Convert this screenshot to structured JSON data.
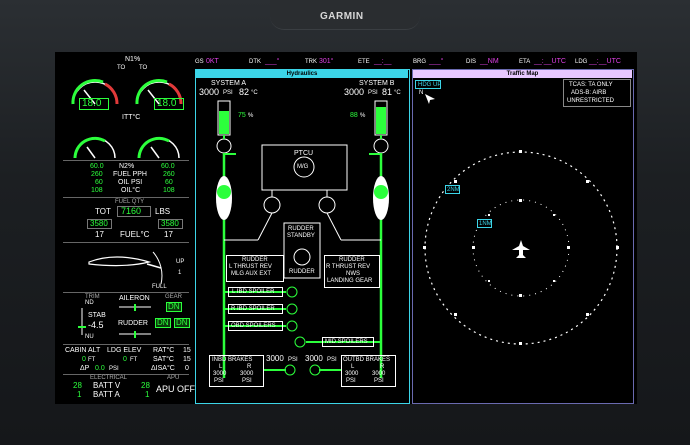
{
  "bezel": {
    "brand": "GARMIN"
  },
  "topbar": {
    "gs_label": "GS",
    "gs_value": "0KT",
    "dtk_label": "DTK",
    "dtk_value": "___°",
    "trk_label": "TRK",
    "trk_value": "301°",
    "ete_label": "ETE",
    "ete_value": "__:__",
    "brg_label": "BRG",
    "brg_value": "___°",
    "dis_label": "DIS",
    "dis_value": "__NM",
    "eta_label": "ETA",
    "eta_value": "__:__UTC",
    "ldg_label": "LDG",
    "ldg_value": "__:__UTC"
  },
  "engine": {
    "n1_label": "N1%",
    "to_left": "TO",
    "to_right": "TO",
    "n1_left": "18.0",
    "n1_right": "18.0",
    "itt_label": "ITT°C",
    "n2_left": "60.0",
    "n2_label": "N2%",
    "n2_right": "60.0",
    "ff_left": "260",
    "ff_label": "FUEL PPH",
    "ff_right": "260",
    "op_left": "60",
    "op_label": "OIL PSI",
    "op_right": "60",
    "ot_left": "108",
    "ot_label": "OIL°C",
    "ot_right": "108",
    "fuel_qty_label": "FUEL QTY",
    "tot_label": "TOT",
    "tot_value": "7160",
    "tot_unit": "LBS",
    "fq_left": "3580",
    "fq_right": "3580",
    "ft_left": "17",
    "ft_label": "FUEL°C",
    "ft_right": "17",
    "flap_up": "UP",
    "flap_1": "1",
    "flap_full": "FULL",
    "trim_label": "TRIM",
    "stab_nd": "ND",
    "stab_label": "STAB",
    "stab_value": "-4.5",
    "stab_nu": "NU",
    "aileron_label": "AILERON",
    "rudder_label": "RUDDER",
    "gear_label": "GEAR",
    "gear_n": "DN",
    "gear_l": "DN",
    "gear_r": "DN",
    "cabin_alt_label": "CABIN ALT",
    "cabin_alt_value": "0",
    "cabin_alt_unit": "FT",
    "ldg_elev_label": "LDG ELEV",
    "ldg_elev_value": "0",
    "ldg_elev_unit": "FT",
    "dp_label": "ΔP",
    "dp_value": "0.0",
    "dp_unit": "PSI",
    "rat_label": "RAT°C",
    "rat_value": "15",
    "sat_label": "SAT°C",
    "sat_value": "15",
    "isa_label": "ΔISA°C",
    "isa_value": "0",
    "electrical_label": "ELECTRICAL",
    "apu_label": "APU",
    "batt_v_left": "28",
    "batt_v_label": "BATT V",
    "batt_v_right": "28",
    "batt_a_left": "1",
    "batt_a_label": "BATT A",
    "batt_a_right": "1",
    "apu_status": "APU OFF"
  },
  "hydraulics": {
    "title": "Hydraulics",
    "sys_a": "SYSTEM A",
    "sys_b": "SYSTEM B",
    "a_psi": "3000",
    "b_psi": "3000",
    "psi": "PSI",
    "a_temp": "82",
    "b_temp": "81",
    "degc": "°C",
    "a_qty": "75",
    "b_qty": "88",
    "pct": "%",
    "ptcu": "PTCU",
    "mg": "M/G",
    "rudder_standby": [
      "RUDDER",
      "STANDBY"
    ],
    "rudder_box": "RUDDER",
    "left_list": [
      "RUDDER",
      "L THRUST REV",
      "MLG AUX EXT"
    ],
    "right_list": [
      "RUDDER",
      "R THRUST REV",
      "NWS",
      "LANDING GEAR"
    ],
    "l_ibd": "L IBD SPOILER",
    "r_ibd": "R IBD SPOILER",
    "obd": "OBD SPOILERS",
    "mid": "MID SPOILERS",
    "inbd": "INBD BRAKES",
    "outbd": "OUTBD BRAKES",
    "l": "L",
    "r": "R",
    "brk_val": "3000",
    "accum_left": "3000",
    "accum_right": "3000"
  },
  "traffic": {
    "title": "Traffic Map",
    "hdg_up": "HDG UP",
    "n_label": "N",
    "tcas": "TCAS: TA ONLY",
    "adsb": "ADS-B: AIRB",
    "unrestricted": "UNRESTRICTED",
    "ring_outer": "2NM",
    "ring_inner": "1NM"
  }
}
